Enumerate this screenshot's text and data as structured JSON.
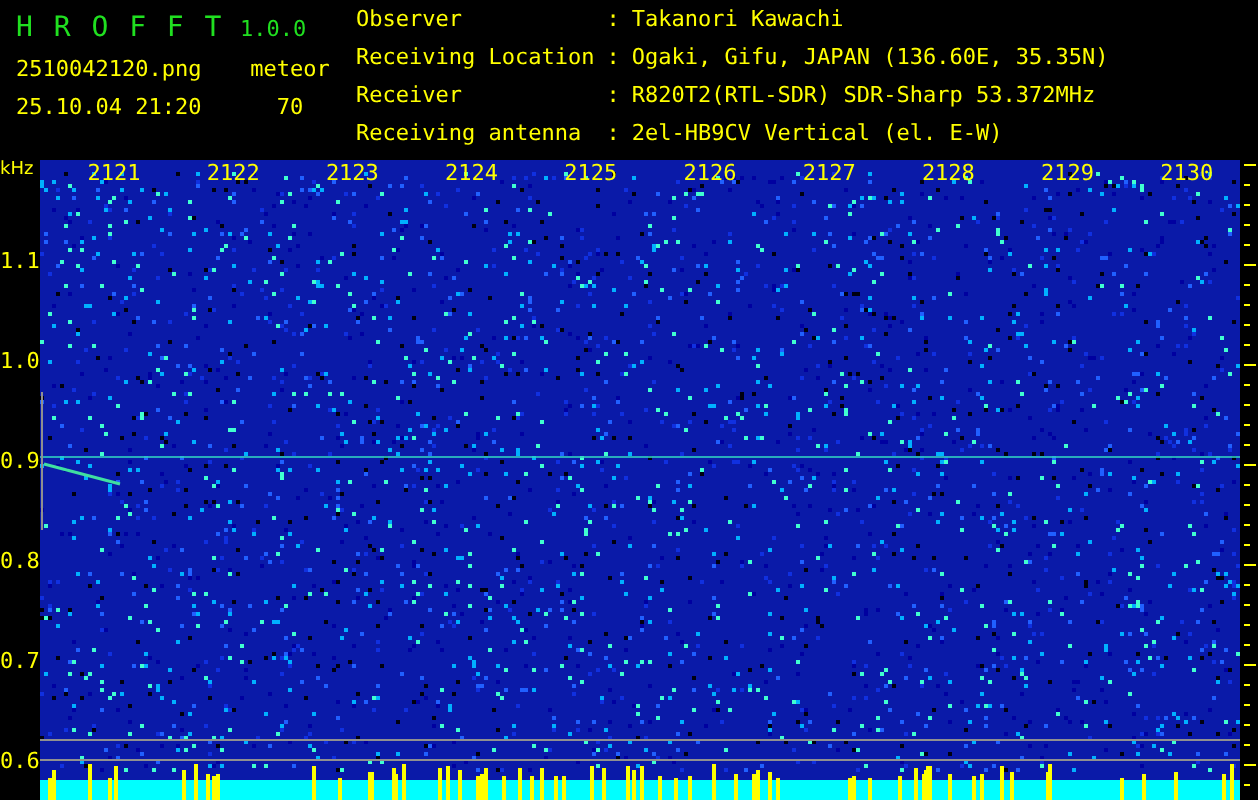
{
  "app": {
    "name": "H R O F F T",
    "version": "1.0.0"
  },
  "file": {
    "name": "2510042120.png",
    "timestamp": "25.10.04 21:20"
  },
  "detection": {
    "label": "meteor",
    "count": "70"
  },
  "station_info": [
    {
      "label": "Observer",
      "separator": ":",
      "value": "Takanori Kawachi"
    },
    {
      "label": "Receiving Location",
      "separator": ":",
      "value": "Ogaki, Gifu, JAPAN (136.60E, 35.35N)"
    },
    {
      "label": "Receiver",
      "separator": ":",
      "value": "R820T2(RTL-SDR) SDR-Sharp 53.372MHz"
    },
    {
      "label": "Receiving antenna",
      "separator": ":",
      "value": "2el-HB9CV Vertical (el. E-W)"
    }
  ],
  "frequency_axis": {
    "unit": "kHz",
    "labels": [
      "1.1",
      "1.0",
      "0.9",
      "0.8",
      "0.7",
      "0.6"
    ]
  },
  "time_axis": {
    "labels": [
      "2121",
      "2122",
      "2123",
      "2124",
      "2125",
      "2126",
      "2127",
      "2128",
      "2129",
      "2130"
    ]
  }
}
